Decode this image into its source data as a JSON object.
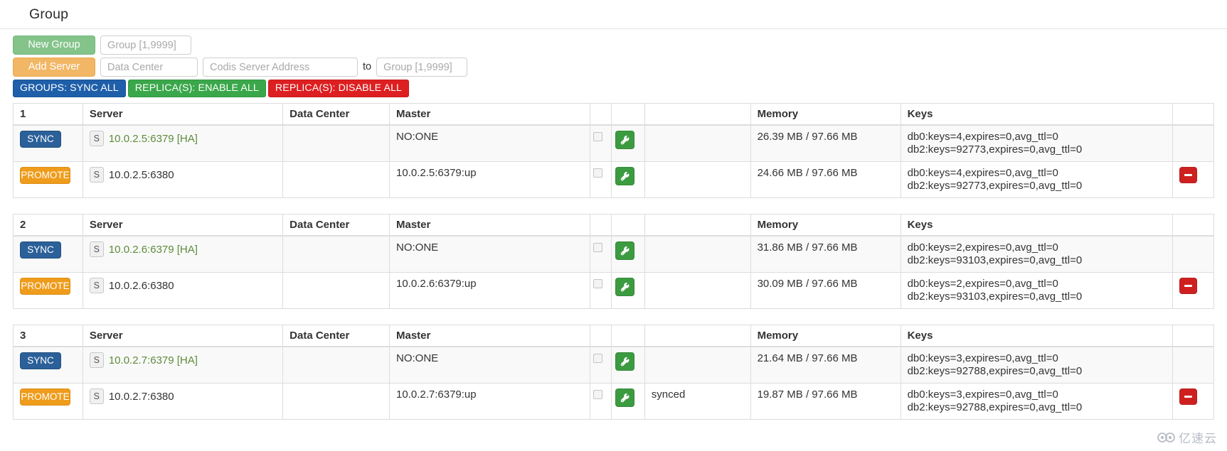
{
  "header": {
    "title": "Group"
  },
  "controls": {
    "new_group_label": "New Group",
    "new_group_placeholder": "Group [1,9999]",
    "add_server_label": "Add Server",
    "data_center_placeholder": "Data Center",
    "server_address_placeholder": "Codis Server Address",
    "to_label": "to",
    "target_group_placeholder": "Group [1,9999]",
    "sync_all_label": "GROUPS: SYNC ALL",
    "enable_all_label": "REPLICA(S): ENABLE ALL",
    "disable_all_label": "REPLICA(S): DISABLE ALL"
  },
  "colors": {
    "new_group": "#84c48a",
    "add_server": "#f2b765",
    "sync_all": "#1f5fa9",
    "enable_all": "#3aa74a",
    "disable_all": "#dd1f21",
    "sync_badge": "#2b6099",
    "promote_badge": "#ef9c1c",
    "wrench": "#3c9b40",
    "delete": "#cf2020",
    "server_link": "#5e8b3a"
  },
  "columns": {
    "server": "Server",
    "data_center": "Data Center",
    "master": "Master",
    "blank1": "",
    "blank2": "",
    "blank3": "",
    "memory": "Memory",
    "keys": "Keys",
    "blank4": ""
  },
  "icons": {
    "wrench": "wrench-icon",
    "minus": "minus-icon",
    "checkbox": "checkbox",
    "s_tag": "slave-tag"
  },
  "groups": [
    {
      "index": "1",
      "rows": [
        {
          "action": "SYNC",
          "action_type": "sync",
          "s_tag": "S",
          "server": "10.0.2.5:6379 [HA]",
          "is_link": true,
          "data_center": "",
          "master": "NO:ONE",
          "state": "",
          "memory": "26.39 MB / 97.66 MB",
          "keys": [
            "db0:keys=4,expires=0,avg_ttl=0",
            "db2:keys=92773,expires=0,avg_ttl=0"
          ],
          "has_delete": false
        },
        {
          "action": "PROMOTE",
          "action_type": "promote",
          "s_tag": "S",
          "server": "10.0.2.5:6380",
          "is_link": false,
          "data_center": "",
          "master": "10.0.2.5:6379:up",
          "state": "",
          "memory": "24.66 MB / 97.66 MB",
          "keys": [
            "db0:keys=4,expires=0,avg_ttl=0",
            "db2:keys=92773,expires=0,avg_ttl=0"
          ],
          "has_delete": true
        }
      ]
    },
    {
      "index": "2",
      "rows": [
        {
          "action": "SYNC",
          "action_type": "sync",
          "s_tag": "S",
          "server": "10.0.2.6:6379 [HA]",
          "is_link": true,
          "data_center": "",
          "master": "NO:ONE",
          "state": "",
          "memory": "31.86 MB / 97.66 MB",
          "keys": [
            "db0:keys=2,expires=0,avg_ttl=0",
            "db2:keys=93103,expires=0,avg_ttl=0"
          ],
          "has_delete": false
        },
        {
          "action": "PROMOTE",
          "action_type": "promote",
          "s_tag": "S",
          "server": "10.0.2.6:6380",
          "is_link": false,
          "data_center": "",
          "master": "10.0.2.6:6379:up",
          "state": "",
          "memory": "30.09 MB / 97.66 MB",
          "keys": [
            "db0:keys=2,expires=0,avg_ttl=0",
            "db2:keys=93103,expires=0,avg_ttl=0"
          ],
          "has_delete": true
        }
      ]
    },
    {
      "index": "3",
      "rows": [
        {
          "action": "SYNC",
          "action_type": "sync",
          "s_tag": "S",
          "server": "10.0.2.7:6379 [HA]",
          "is_link": true,
          "data_center": "",
          "master": "NO:ONE",
          "state": "",
          "memory": "21.64 MB / 97.66 MB",
          "keys": [
            "db0:keys=3,expires=0,avg_ttl=0",
            "db2:keys=92788,expires=0,avg_ttl=0"
          ],
          "has_delete": false
        },
        {
          "action": "PROMOTE",
          "action_type": "promote",
          "s_tag": "S",
          "server": "10.0.2.7:6380",
          "is_link": false,
          "data_center": "",
          "master": "10.0.2.7:6379:up",
          "state": "synced",
          "memory": "19.87 MB / 97.66 MB",
          "keys": [
            "db0:keys=3,expires=0,avg_ttl=0",
            "db2:keys=92788,expires=0,avg_ttl=0"
          ],
          "has_delete": true
        }
      ]
    }
  ],
  "watermark": {
    "text": "亿速云"
  }
}
